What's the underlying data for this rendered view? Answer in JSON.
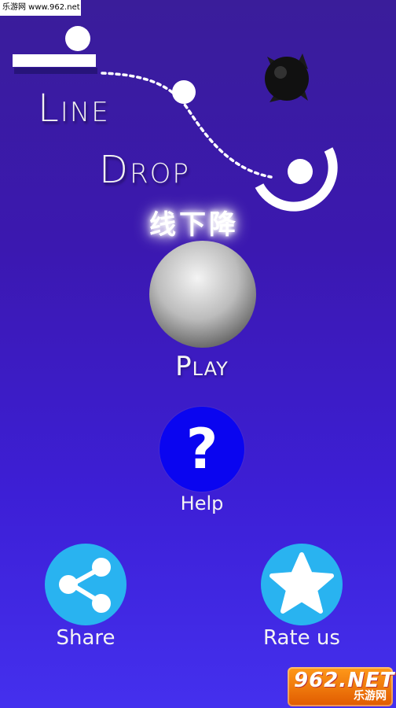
{
  "watermark_top": "乐游网 www.962.net",
  "title": {
    "line1": "Line",
    "line2": "Drop",
    "chinese": "线下降"
  },
  "play": {
    "label": "Play"
  },
  "help": {
    "icon_glyph": "?",
    "label": "Help"
  },
  "share": {
    "icon": "share-icon",
    "label": "Share"
  },
  "rate": {
    "icon": "star-icon",
    "label": "Rate us"
  },
  "watermark_bottom": {
    "brand": "962.NET",
    "sub": "乐游网"
  },
  "colors": {
    "background_top": "#3a1d9a",
    "background_bottom": "#4430ee",
    "help_button": "#0a05f0",
    "round_button": "#29b3f0"
  }
}
